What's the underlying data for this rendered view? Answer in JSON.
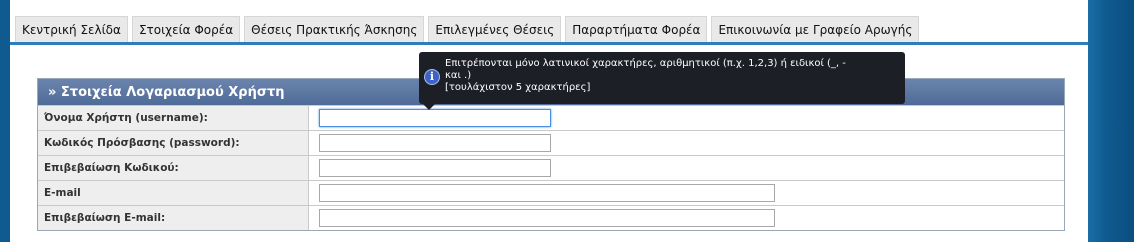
{
  "tabs": [
    {
      "label": "Κεντρική Σελίδα"
    },
    {
      "label": "Στοιχεία Φορέα"
    },
    {
      "label": "Θέσεις Πρακτικής Άσκησης"
    },
    {
      "label": "Επιλεγμένες Θέσεις"
    },
    {
      "label": "Παραρτήματα Φορέα"
    },
    {
      "label": "Επικοινωνία με Γραφείο Αρωγής"
    }
  ],
  "panel": {
    "title": "» Στοιχεία Λογαριασμού Χρήστη",
    "rows": [
      {
        "label": "Όνομα Χρήστη (username):",
        "value": ""
      },
      {
        "label": "Κωδικός Πρόσβασης (password):",
        "value": ""
      },
      {
        "label": "Επιβεβαίωση Κωδικού:",
        "value": ""
      },
      {
        "label": "E-mail",
        "value": ""
      },
      {
        "label": "Επιβεβαίωση E-mail:",
        "value": ""
      }
    ]
  },
  "tooltip": {
    "line1": "Επιτρέπονται μόνο λατινικοί χαρακτήρες, αριθμητικοί (π.χ. 1,2,3) ή ειδικοί (_, -",
    "line2": "και .)",
    "line3": "[τουλάχιστον 5 χαρακτήρες]",
    "icon": "info-icon"
  },
  "colors": {
    "accent": "#2b7fc0",
    "header": "#4f6b98",
    "side": "#0f5a8f"
  }
}
